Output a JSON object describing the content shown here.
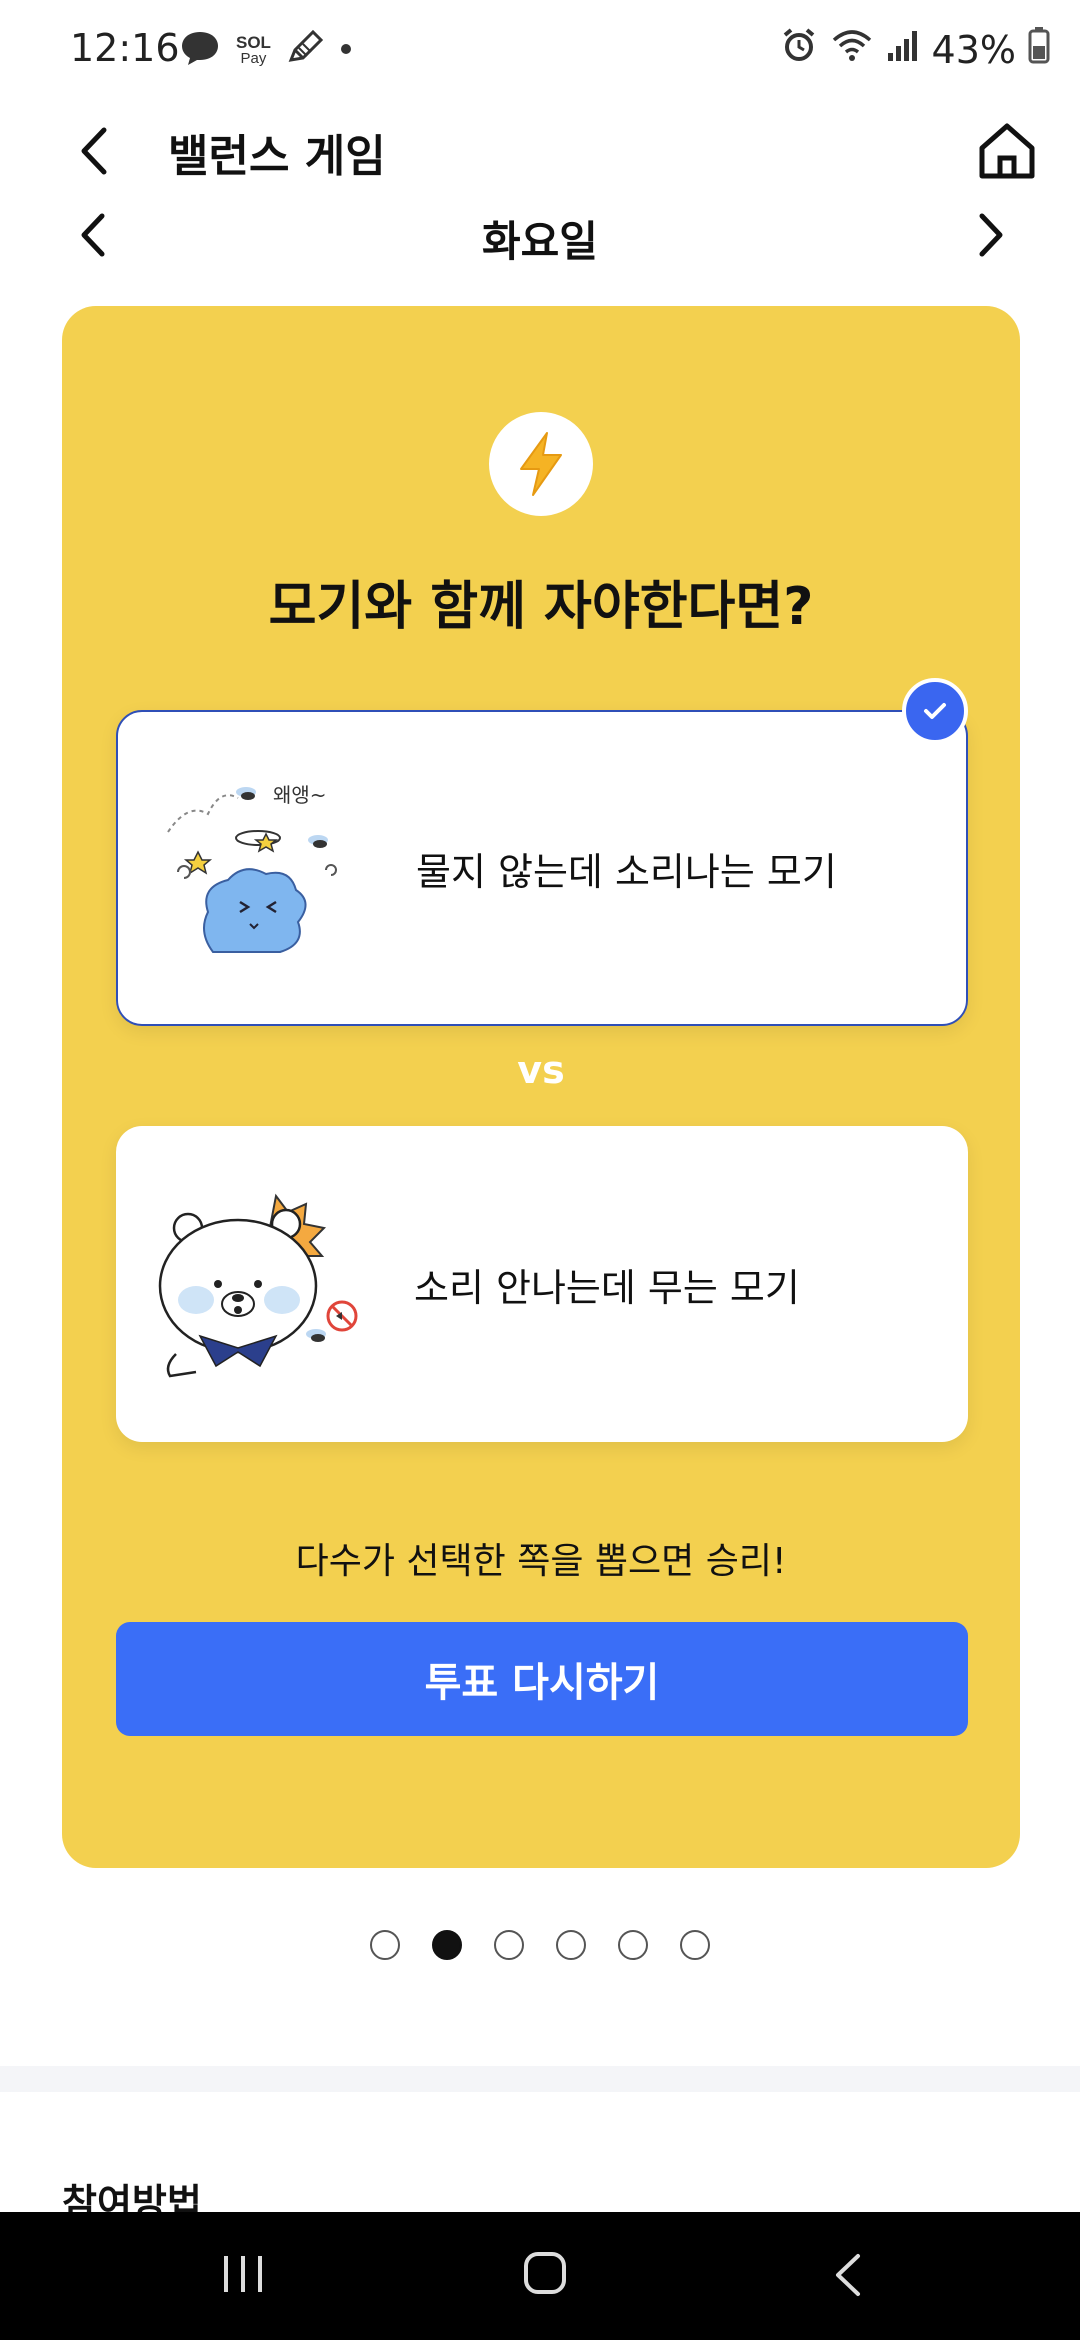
{
  "status_bar": {
    "time": "12:16",
    "battery": "43%",
    "pay_label_top": "SOL",
    "pay_label_bottom": "Pay"
  },
  "header": {
    "title": "밸런스 게임"
  },
  "day_nav": {
    "label": "화요일"
  },
  "card": {
    "question": "모기와 함께 자야한다면?",
    "vs_label": "vs",
    "option_a": {
      "text": "물지 않는데 소리나는 모기",
      "illustration_caption": "왜앵~",
      "selected": true
    },
    "option_b": {
      "text": "소리 안나는데 무는 모기",
      "selected": false
    },
    "hint": "다수가 선택한 쪽을 뽑으면 승리!",
    "revote_button": "투표 다시하기"
  },
  "pagination": {
    "total": 6,
    "active_index": 1
  },
  "section": {
    "howto_title": "참여방법"
  },
  "colors": {
    "card_bg": "#f3d04f",
    "accent": "#3a6ef7",
    "selected_border": "#2f4fb7"
  }
}
